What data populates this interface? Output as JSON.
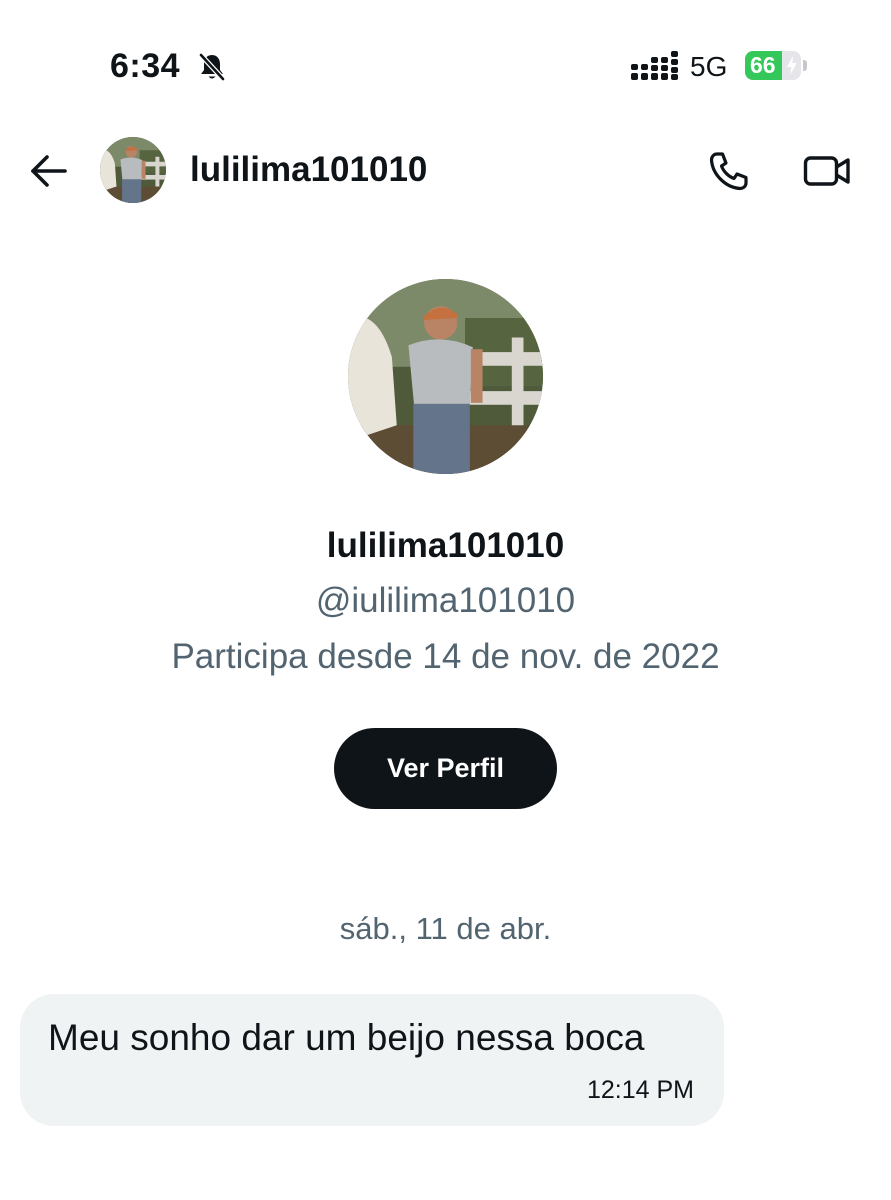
{
  "status_bar": {
    "time": "6:34",
    "network": "5G",
    "battery_percent": "66",
    "battery_level": 0.66,
    "icons": [
      "bell-slash-icon",
      "cellular-signal-icon",
      "battery-charging-icon"
    ]
  },
  "header": {
    "username": "lulilima101010",
    "icons": [
      "back-arrow-icon",
      "avatar",
      "phone-icon",
      "video-camera-icon"
    ]
  },
  "profile": {
    "name": "lulilima101010",
    "handle": "@iulilima101010",
    "joined": "Participa desde 14 de nov. de 2022",
    "button_label": "Ver Perfil"
  },
  "conversation": {
    "date_separator": "sáb., 11 de abr.",
    "messages": [
      {
        "text": "Meu sonho dar um beijo nessa boca",
        "time": "12:14 PM"
      }
    ]
  },
  "colors": {
    "text_primary": "#0f1419",
    "text_secondary": "#536471",
    "button_bg": "#0f1419",
    "bubble_bg": "#eff3f4",
    "battery_green": "#34c759"
  }
}
